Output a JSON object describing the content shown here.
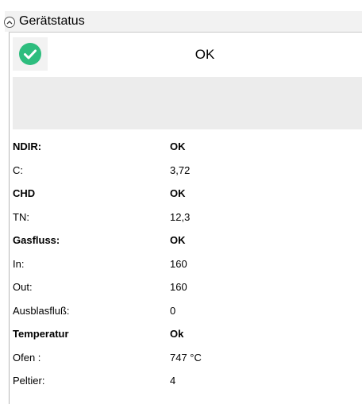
{
  "header": {
    "title": "Gerätstatus",
    "collapse_icon": "chevron-up-circle-icon"
  },
  "status": {
    "icon": "check-circle-icon",
    "icon_color": "#2dbd7e",
    "text": "OK"
  },
  "rows": [
    {
      "label": "NDIR:",
      "value": "OK",
      "bold": true
    },
    {
      "label": "C:",
      "value": "3,72",
      "bold": false
    },
    {
      "label": "CHD",
      "value": "OK",
      "bold": true
    },
    {
      "label": "TN:",
      "value": "12,3",
      "bold": false
    },
    {
      "label": "Gasfluss:",
      "value": "OK",
      "bold": true
    },
    {
      "label": "In:",
      "value": "160",
      "bold": false
    },
    {
      "label": "Out:",
      "value": "160",
      "bold": false
    },
    {
      "label": "Ausblasfluß:",
      "value": "0",
      "bold": false
    },
    {
      "label": "Temperatur",
      "value": "Ok",
      "bold": true
    },
    {
      "label": "Ofen :",
      "value": "747 °C",
      "bold": false
    },
    {
      "label": "Peltier:",
      "value": "4",
      "bold": false
    }
  ]
}
